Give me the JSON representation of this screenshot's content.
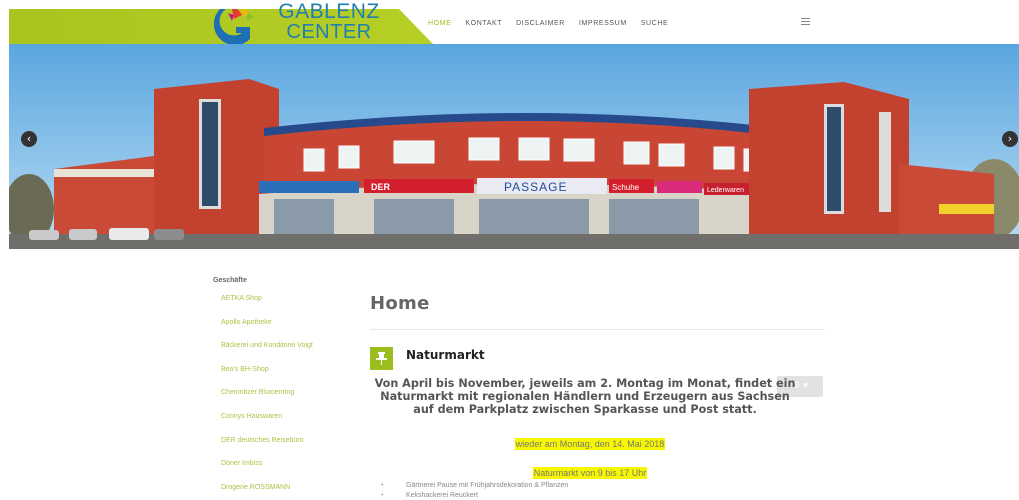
{
  "logo": {
    "line1": "GABLENZ",
    "line2": "CENTER"
  },
  "nav": {
    "items": [
      "HOME",
      "KONTAKT",
      "DISCLAIMER",
      "IMPRESSUM",
      "SUCHE"
    ]
  },
  "slider": {
    "prev_glyph": "‹",
    "next_glyph": "›",
    "signs": {
      "passage": "PASSAGE",
      "der": "DER",
      "schuhe": "Schuhe",
      "leder": "Lederwaren"
    }
  },
  "sidebar": {
    "title": "Geschäfte",
    "items": [
      "AETKA Shop",
      "Apollo Apotheke",
      "Bäckerei und Konditorei Voigt",
      "Bea's BH-Shop",
      "Chemnitzer Blumenring",
      "Connys Hauswaren",
      "DER deutsches Reisebüro",
      "Döner Imbiss",
      "Drogerie ROSSMANN"
    ]
  },
  "main": {
    "page_title": "Home",
    "article_title": "Naturmarkt",
    "gear_label": "⚙ ▾",
    "lead": "Von April bis November, jeweils am 2. Montag im Monat, findet ein Naturmarkt mit regionalen Händlern und Erzeugern aus Sachsen auf dem Parkplatz zwischen Sparkasse und Post statt.",
    "highlight1": "wieder am Montag, den 14. Mai 2018",
    "highlight2": "Naturmarkt von 9 bis 17 Uhr",
    "bullets": [
      "Gärtnerei Pause mit Frühjahrsdekoration & Pflanzen",
      "Kekshackerei Reuckert"
    ]
  },
  "colors": {
    "brand_green": "#9bbd1d",
    "brand_blue": "#1f7fb1",
    "highlight": "#f7f700"
  }
}
